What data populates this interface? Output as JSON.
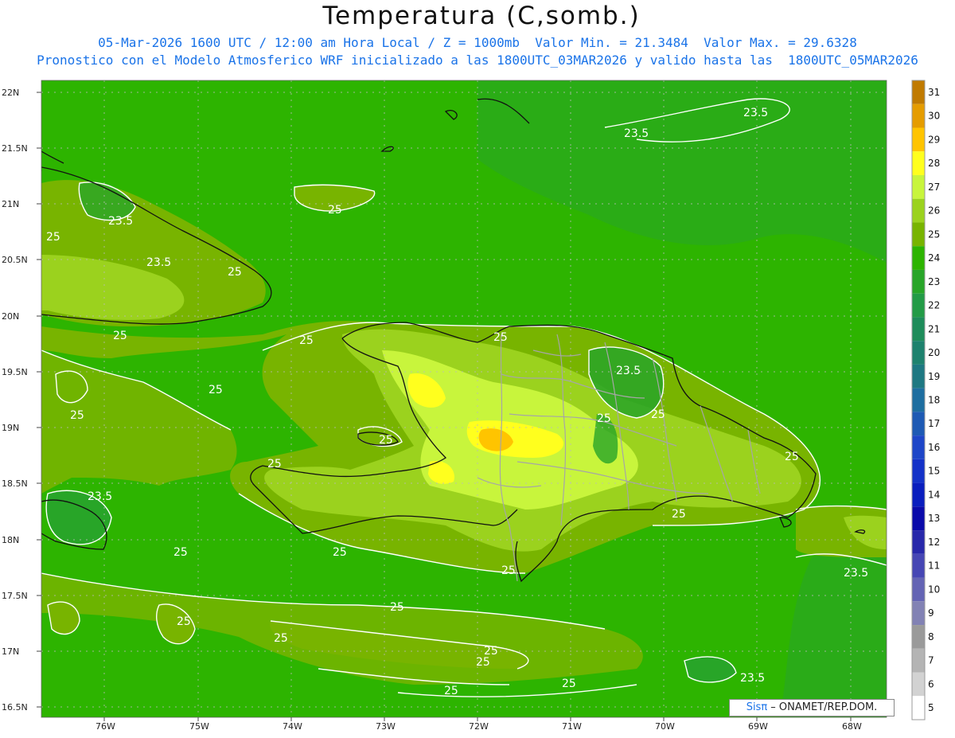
{
  "title": "Temperatura (C,somb.)",
  "subtitle_1": "05-Mar-2026 1600 UTC / 12:00 am Hora Local / Z = 1000mb  Valor Min. = 21.3484  Valor Max. = 29.6328",
  "subtitle_2": "Pronostico con el Modelo Atmosferico WRF inicializado a las 1800UTC_03MAR2026 y valido hasta las  1800UTC_05MAR2026",
  "credit": {
    "brand": "Sisπ",
    "text": " – ONAMET/REP.DOM."
  },
  "latitudes": [
    "22N",
    "21.5N",
    "21N",
    "20.5N",
    "20N",
    "19.5N",
    "19N",
    "18.5N",
    "18N",
    "17.5N",
    "17N",
    "16.5N"
  ],
  "longitudes": [
    "76W",
    "75W",
    "74W",
    "73W",
    "72W",
    "71W",
    "70W",
    "69W",
    "68W"
  ],
  "colorbar": {
    "levels": [
      31,
      30,
      29,
      28,
      27,
      26,
      25,
      24,
      23,
      22,
      21,
      20,
      19,
      18,
      17,
      16,
      15,
      14,
      13,
      12,
      11,
      10,
      9,
      8,
      7,
      6,
      5
    ],
    "colors": [
      "#c07a00",
      "#e59c00",
      "#ffc400",
      "#ffff1e",
      "#c8f53c",
      "#9bd21e",
      "#78b400",
      "#2db400",
      "#28a528",
      "#239b46",
      "#1e8c5a",
      "#1e826e",
      "#1e7882",
      "#1e6ea0",
      "#1e5ab4",
      "#1e46c8",
      "#1432c8",
      "#0a1ebe",
      "#0a0aaa",
      "#2828aa",
      "#4646b4",
      "#6464b4",
      "#8282b4",
      "#9a9a9a",
      "#b4b4b4",
      "#d2d2d2",
      "#ffffff"
    ]
  },
  "contour_labels": [
    {
      "text": "23.5"
    },
    {
      "text": "23.5"
    },
    {
      "text": "25"
    },
    {
      "text": "25"
    },
    {
      "text": "23.5"
    },
    {
      "text": "23.5"
    },
    {
      "text": "25"
    },
    {
      "text": "25"
    },
    {
      "text": "25"
    },
    {
      "text": "25"
    },
    {
      "text": "25"
    },
    {
      "text": "25"
    },
    {
      "text": "25"
    },
    {
      "text": "23.5"
    },
    {
      "text": "25"
    },
    {
      "text": "25"
    },
    {
      "text": "25"
    },
    {
      "text": "25"
    },
    {
      "text": "23.5"
    },
    {
      "text": "25"
    },
    {
      "text": "25"
    },
    {
      "text": "25"
    },
    {
      "text": "25"
    },
    {
      "text": "25"
    },
    {
      "text": "25"
    },
    {
      "text": "25"
    },
    {
      "text": "25"
    },
    {
      "text": "25"
    },
    {
      "text": "23.5"
    },
    {
      "text": "23.5"
    },
    {
      "text": "25"
    },
    {
      "text": "25"
    }
  ]
}
